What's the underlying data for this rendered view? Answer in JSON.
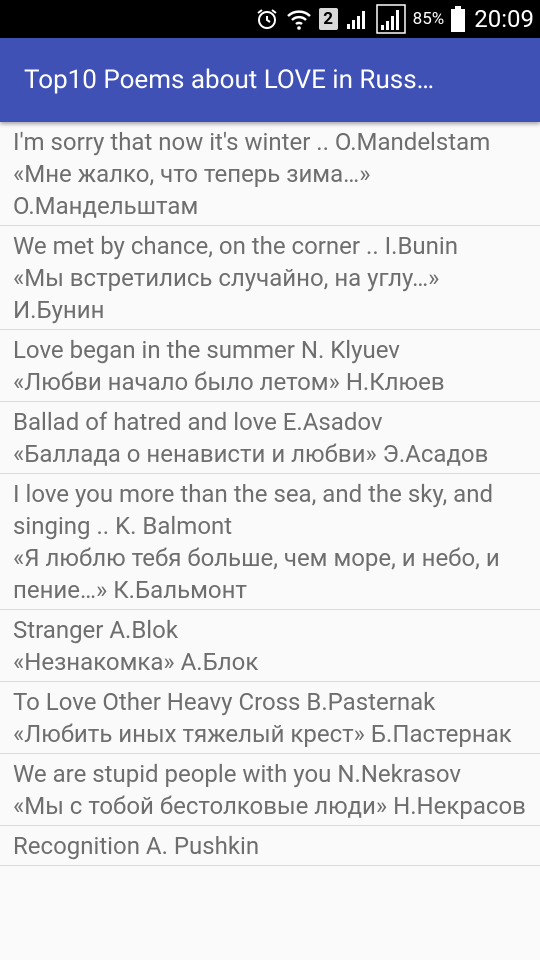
{
  "status_bar": {
    "icons": [
      "alarm-icon",
      "wifi-icon",
      "sim-2-badge",
      "signal-icon",
      "signal-icon",
      "battery-icon"
    ],
    "sim_badge": "2",
    "battery_percent": "85%",
    "time": "20:09"
  },
  "app_bar": {
    "title": "Top10 Poems about LOVE in Russ…",
    "color": "#3f51b5"
  },
  "poems": [
    {
      "text": "I'm sorry that now it's winter .. O.Mandelstam\n «Мне жалко, что теперь зима…» О.Мандельштам"
    },
    {
      "text": "We met by chance, on the corner .. I.Bunin\n «Мы встретились случайно, на углу…» И.Бунин"
    },
    {
      "text": "Love began in the summer N. Klyuev\n «Любви начало было летом» Н.Клюев"
    },
    {
      "text": "Ballad of hatred and love E.Asadov\n «Баллада о ненависти и любви» Э.Асадов"
    },
    {
      "text": "I love you more than the sea, and the sky, and singing .. K. Balmont\n «Я люблю тебя больше, чем море, и небо, и пение…» К.Бальмонт"
    },
    {
      "text": "Stranger A.Blok\n «Незнакомка» А.Блок"
    },
    {
      "text": "To Love Other Heavy Cross B.Pasternak\n «Любить иных тяжелый крест» Б.Пастернак"
    },
    {
      "text": "We are stupid people with you N.Nekrasov\n «Мы с тобой бестолковые люди» Н.Некрасов"
    },
    {
      "text": "Recognition A. Pushkin"
    }
  ]
}
